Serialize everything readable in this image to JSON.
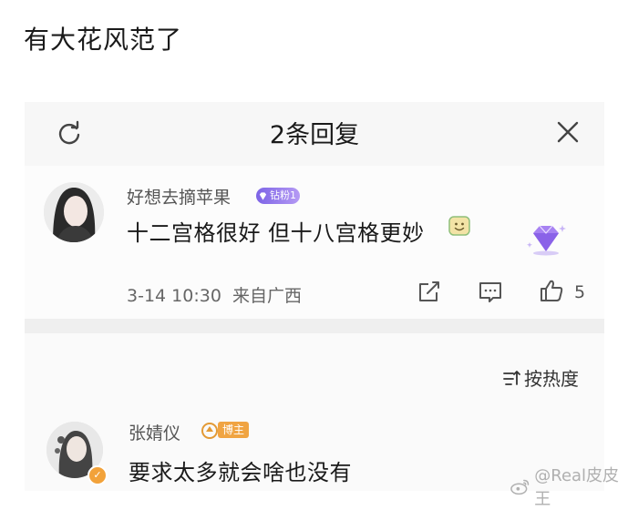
{
  "caption": "有大花风范了",
  "panel": {
    "title": "2条回复",
    "refresh_icon": "refresh-icon",
    "close_icon": "close-icon"
  },
  "comment": {
    "username": "好想去摘苹果",
    "fan_badge": "钻粉1",
    "text": "十二宫格很好 但十八宫格更妙",
    "time": "3-14 10:30",
    "location": "来自广西",
    "like_count": "5",
    "emoji_icon": "smiling-emoji-icon",
    "actions": [
      "share-icon",
      "reply-icon",
      "like-icon"
    ]
  },
  "sort": {
    "label": "按热度",
    "icon": "sort-icon"
  },
  "reply": {
    "username": "张婧仪",
    "host_badge": "博主",
    "text": "要求太多就会啥也没有"
  },
  "watermark": "@Real皮皮王",
  "colors": {
    "fan_badge": "#7d64e6",
    "host_badge": "#f0a442",
    "background": "#ffffff",
    "panel": "#fafafa"
  }
}
